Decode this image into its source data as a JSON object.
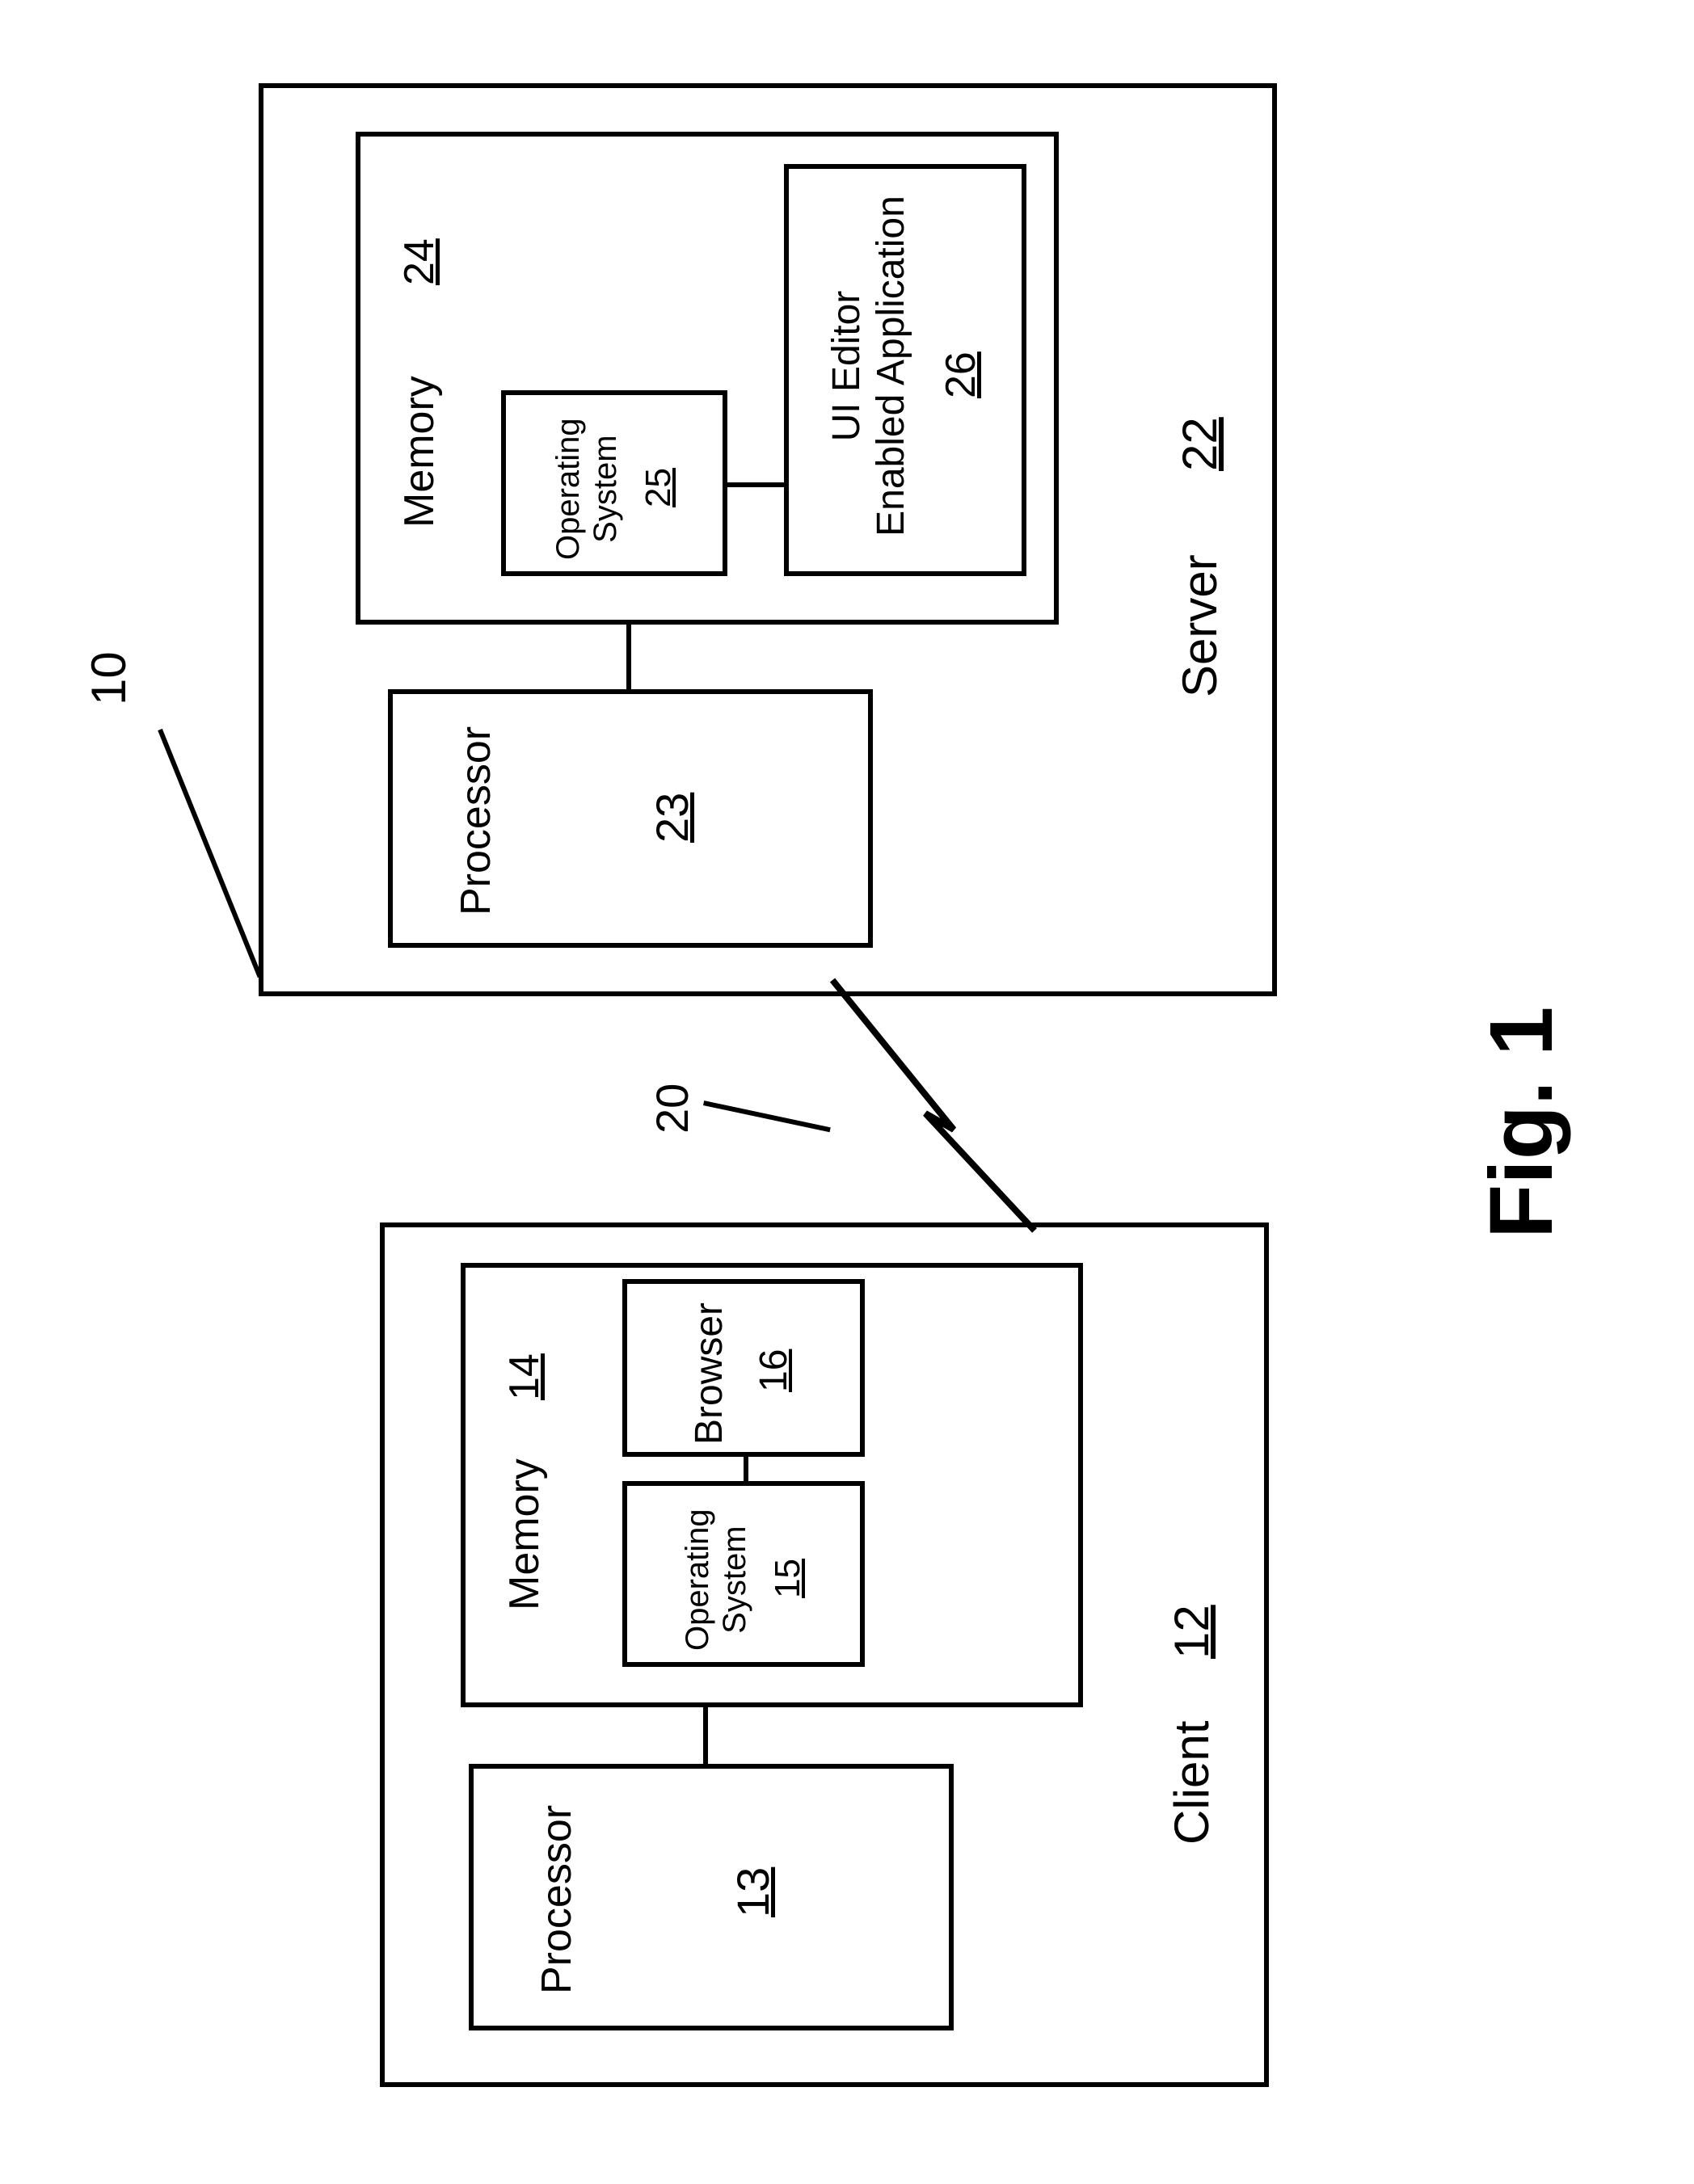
{
  "figure": {
    "ref": "10",
    "caption": "Fig. 1",
    "link": {
      "ref": "20"
    }
  },
  "client": {
    "label": "Client",
    "ref": "12",
    "processor": {
      "label": "Processor",
      "ref": "13"
    },
    "memory": {
      "label": "Memory",
      "ref": "14",
      "os": {
        "label": "Operating\nSystem",
        "ref": "15"
      },
      "browser": {
        "label": "Browser",
        "ref": "16"
      }
    }
  },
  "server": {
    "label": "Server",
    "ref": "22",
    "processor": {
      "label": "Processor",
      "ref": "23"
    },
    "memory": {
      "label": "Memory",
      "ref": "24",
      "os": {
        "label": "Operating\nSystem",
        "ref": "25"
      },
      "app": {
        "label": "UI Editor\nEnabled Application",
        "ref": "26"
      }
    }
  }
}
